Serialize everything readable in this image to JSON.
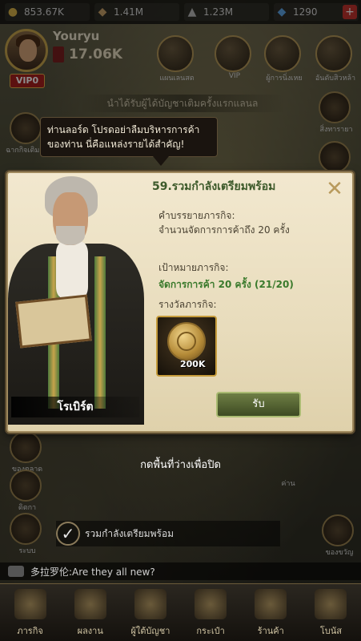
{
  "resources": [
    {
      "icon": "gold-coin-icon",
      "value": "853.67K"
    },
    {
      "icon": "merchandise-icon",
      "value": "1.41M"
    },
    {
      "icon": "soldier-icon",
      "value": "1.23M"
    },
    {
      "icon": "gem-icon",
      "value": "1290"
    }
  ],
  "player": {
    "name": "Youryu",
    "vip": "VIP0",
    "power": "17.06K"
  },
  "top_icons": [
    {
      "label": "แผนเลนสต"
    },
    {
      "label": "VIP"
    },
    {
      "label": "ผู้การนิ่งเหย"
    },
    {
      "label": "อันดับสิวหล้า"
    }
  ],
  "banner": "นำได้รับผู้ได้บัญชาเติมครั้งแรกแลนล",
  "left_side": [
    {
      "label": "ฉากกิจเติมฮิน"
    },
    {
      "label": "ของตลาด"
    },
    {
      "label": "ดิตกา"
    },
    {
      "label": "ระบบ"
    }
  ],
  "right_side": [
    {
      "label": "สิ่งทารายา"
    },
    {
      "label": "ค่าน"
    },
    {
      "label": "ของขวัญ"
    }
  ],
  "bubble": {
    "line1": "ท่านลอร์ด โปรดอย่าลืมบริหารการค้า",
    "line2": "ของท่าน นี่คือแหล่งรายได้สำคัญ!"
  },
  "dialog": {
    "title": "59.รวมกำลังเตรียมพร้อม",
    "desc_label": "คำบรรยายภารกิจ:",
    "desc": "จำนวนจัดการการค้าถึง 20 ครั้ง",
    "target_label": "เป้าหมายภารกิจ:",
    "target": "จัดการการค้า 20 ครั้ง (21/20)",
    "reward_label": "รางวัลภารกิจ:",
    "reward_amount": "200K",
    "claim": "รับ",
    "character": "โรเบิร์ต"
  },
  "hint": "กดพื้นที่ว่างเพื่อปิด",
  "quest_bar": "รวมกำลังเตรียมพร้อม",
  "chat": "多拉罗伦:Are they all new?",
  "bottom_nav": [
    {
      "icon": "scroll-icon",
      "label": "ภารกิจ"
    },
    {
      "icon": "trophy-icon",
      "label": "ผลงาน"
    },
    {
      "icon": "helmet-icon",
      "label": "ผู้ใต้บัญชา"
    },
    {
      "icon": "bag-icon",
      "label": "กระเป๋า"
    },
    {
      "icon": "chest-icon",
      "label": "ร้านค้า"
    },
    {
      "icon": "chest-icon",
      "label": "โบนัส"
    }
  ]
}
